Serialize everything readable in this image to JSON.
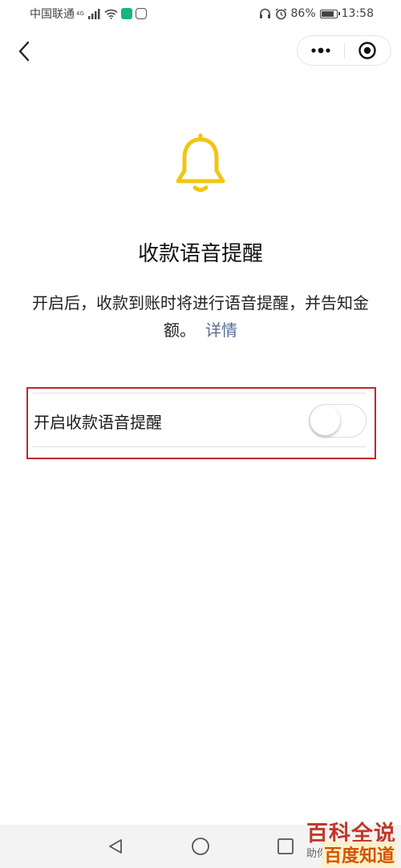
{
  "status_bar": {
    "carrier": "中国联通",
    "network_type": "4G",
    "battery_level": "86%",
    "battery_fraction": 0.86,
    "time": "13:58",
    "icons": [
      "signal-icon",
      "wifi-icon",
      "app-notification-icon",
      "app-notification-icon",
      "headset-icon",
      "alarm-icon",
      "battery-icon"
    ]
  },
  "nav": {
    "back_icon": "chevron-left-icon",
    "more_icon": "more-dots-icon",
    "close_icon": "target-circle-icon"
  },
  "hero": {
    "icon": "bell-icon",
    "icon_color": "#f2c511",
    "title": "收款语音提醒",
    "description": "开启后，收款到账时将进行语音提醒，并告知金额。",
    "link": "详情",
    "link_color": "#576b95"
  },
  "setting": {
    "label": "开启收款语音提醒",
    "enabled": false
  },
  "annotation": {
    "highlight_color": "#c2262d"
  },
  "system_nav": {
    "icons": [
      "back-triangle-icon",
      "home-circle-icon",
      "recents-square-icon"
    ]
  },
  "watermark": {
    "main": "百科全说",
    "sub_small": "助你",
    "sub": "百度知道"
  }
}
